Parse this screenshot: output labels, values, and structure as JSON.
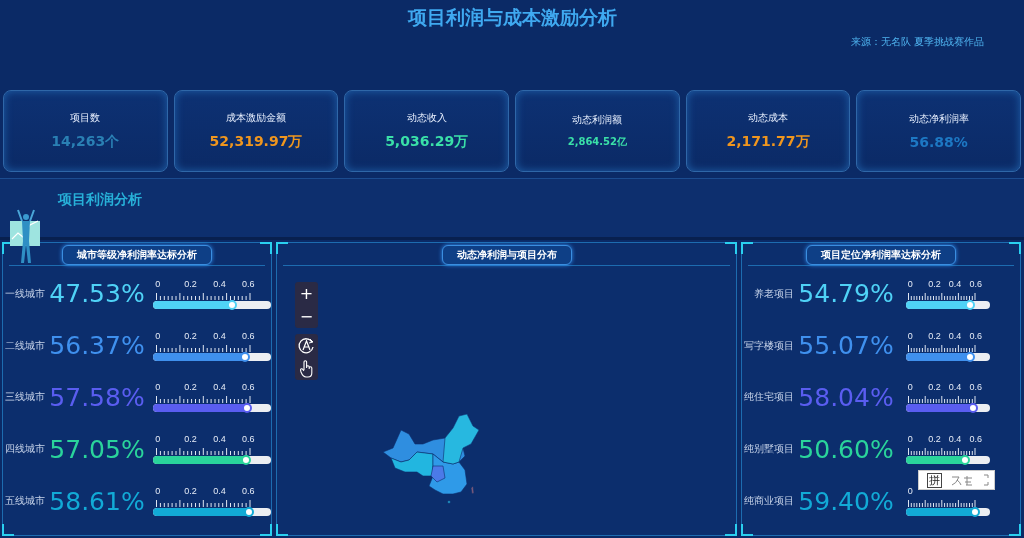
{
  "title": "项目利润与成本激励分析",
  "source": "来源：无名队 夏季挑战赛作品",
  "kpis": [
    {
      "label": "项目数",
      "value": "14,263个",
      "color": "#2a80b4",
      "kind": "large"
    },
    {
      "label": "成本激励金额",
      "value": "52,319.97万",
      "color": "#f0961e",
      "kind": "large"
    },
    {
      "label": "动态收入",
      "value": "5,036.29万",
      "color": "#3ae0a8",
      "kind": "large"
    },
    {
      "label": "动态利润额",
      "value": "2,864.52亿",
      "color": "#3ae0a8",
      "kind": "small"
    },
    {
      "label": "动态成本",
      "value": "2,171.77万",
      "color": "#f0961e",
      "kind": "large"
    },
    {
      "label": "动态净利润率",
      "value": "56.88%",
      "color": "#1d78c4",
      "kind": "large"
    }
  ],
  "section": {
    "title": "项目利润分析"
  },
  "city_panel": {
    "title": "城市等级净利润率达标分析",
    "rows": [
      {
        "label": "一线城市",
        "value": "47.53%",
        "color": "#4fd2f6",
        "level": 0.67,
        "ticks": [
          "0",
          "0.2",
          "0.4",
          "0.6"
        ]
      },
      {
        "label": "二线城市",
        "value": "56.37%",
        "color": "#3f90ee",
        "level": 0.78,
        "ticks": [
          "0",
          "0.2",
          "0.4",
          "0.6"
        ]
      },
      {
        "label": "三线城市",
        "value": "57.58%",
        "color": "#5a5df0",
        "level": 0.8,
        "ticks": [
          "0",
          "0.2",
          "0.4",
          "0.6"
        ]
      },
      {
        "label": "四线城市",
        "value": "57.05%",
        "color": "#2ad49b",
        "level": 0.79,
        "ticks": [
          "0",
          "0.2",
          "0.4",
          "0.6"
        ]
      },
      {
        "label": "五线城市",
        "value": "58.61%",
        "color": "#12aad6",
        "level": 0.81,
        "ticks": [
          "0",
          "0.2",
          "0.4",
          "0.6"
        ]
      }
    ]
  },
  "map_panel": {
    "title": "动态净利润与项目分布",
    "zoom_buttons": [
      "+",
      "−"
    ]
  },
  "project_panel": {
    "title": "项目定位净利润率达标分析",
    "rows": [
      {
        "label": "养老项目",
        "value": "54.79%",
        "color": "#4fd2f6",
        "level": 0.76,
        "ticks": [
          "0",
          "0.2",
          "0.4",
          "0.6"
        ]
      },
      {
        "label": "写字楼项目",
        "value": "55.07%",
        "color": "#3f90ee",
        "level": 0.76,
        "ticks": [
          "0",
          "0.2",
          "0.4",
          "0.6"
        ]
      },
      {
        "label": "纯住宅项目",
        "value": "58.04%",
        "color": "#5a5df0",
        "level": 0.8,
        "ticks": [
          "0",
          "0.2",
          "0.4",
          "0.6"
        ]
      },
      {
        "label": "纯别墅项目",
        "value": "50.60%",
        "color": "#2ad49b",
        "level": 0.7,
        "ticks": [
          "0",
          "0.2",
          "0.4",
          "0.6"
        ]
      },
      {
        "label": "纯商业项目",
        "value": "59.40%",
        "color": "#12aad6",
        "level": 0.82,
        "ticks": [
          "0"
        ]
      }
    ]
  },
  "ime_toolbar": {
    "label": "拼"
  }
}
